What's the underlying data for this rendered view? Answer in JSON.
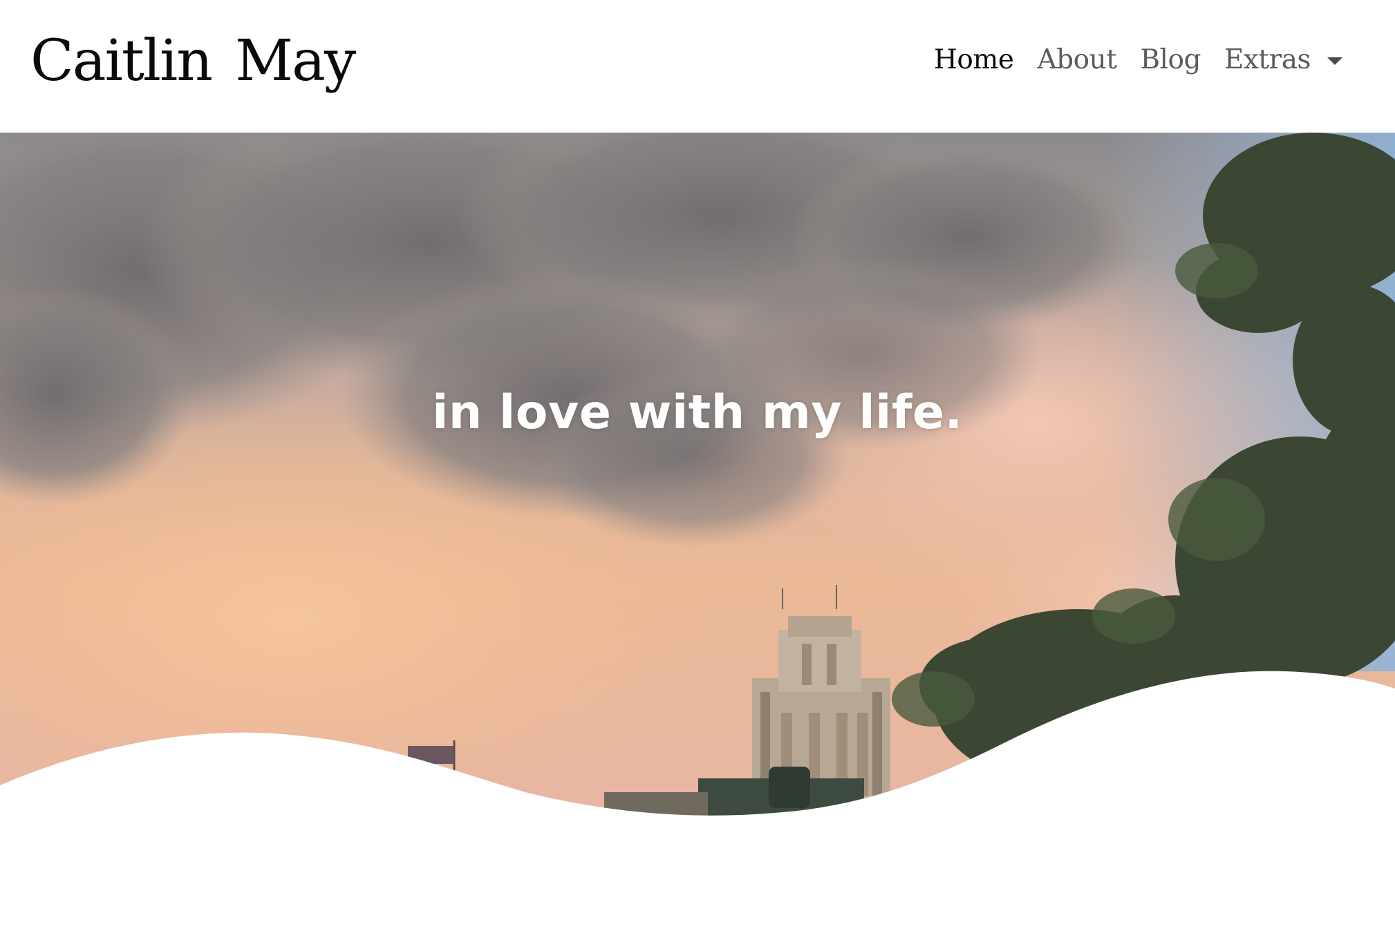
{
  "header": {
    "brand": "Caitlin May",
    "nav": [
      {
        "label": "Home",
        "active": true
      },
      {
        "label": "About",
        "active": false
      },
      {
        "label": "Blog",
        "active": false
      },
      {
        "label": "Extras",
        "active": false,
        "dropdown": true
      }
    ]
  },
  "hero": {
    "tagline": "in love with my life.",
    "background": "sunset-cloud-sky-photo"
  },
  "colors": {
    "nav_active": "#0d0d0d",
    "nav_inactive": "#5b5b5b",
    "hero_text": "#ffffff"
  }
}
